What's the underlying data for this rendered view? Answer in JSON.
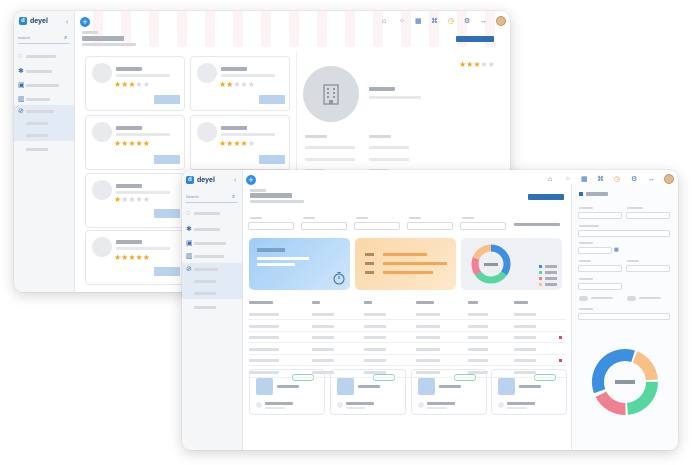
{
  "brand": {
    "name": "deyel",
    "logo_mark": "d"
  },
  "back_window": {
    "search_placeholder": "search",
    "cards": [
      {
        "rating": 3
      },
      {
        "rating": 2
      },
      {
        "rating": 5
      },
      {
        "rating": 4
      },
      {
        "rating": 1
      },
      {
        "rating": 5
      }
    ],
    "detail_rating": 3
  },
  "front_window": {
    "search_placeholder": "Search"
  },
  "colors": {
    "accent": "#2d8ee8",
    "star": "#f2a71b",
    "donut_blue": "#3d8fe0",
    "donut_green": "#58d6a0",
    "donut_orange": "#f7c089",
    "donut_red": "#f07f8f"
  },
  "icons": [
    "home-icon",
    "grid-icon",
    "calendar-icon",
    "bank-icon",
    "stopwatch-icon",
    "user-settings-icon",
    "collapse-icon",
    "plus-icon",
    "search-icon",
    "building-icon"
  ]
}
